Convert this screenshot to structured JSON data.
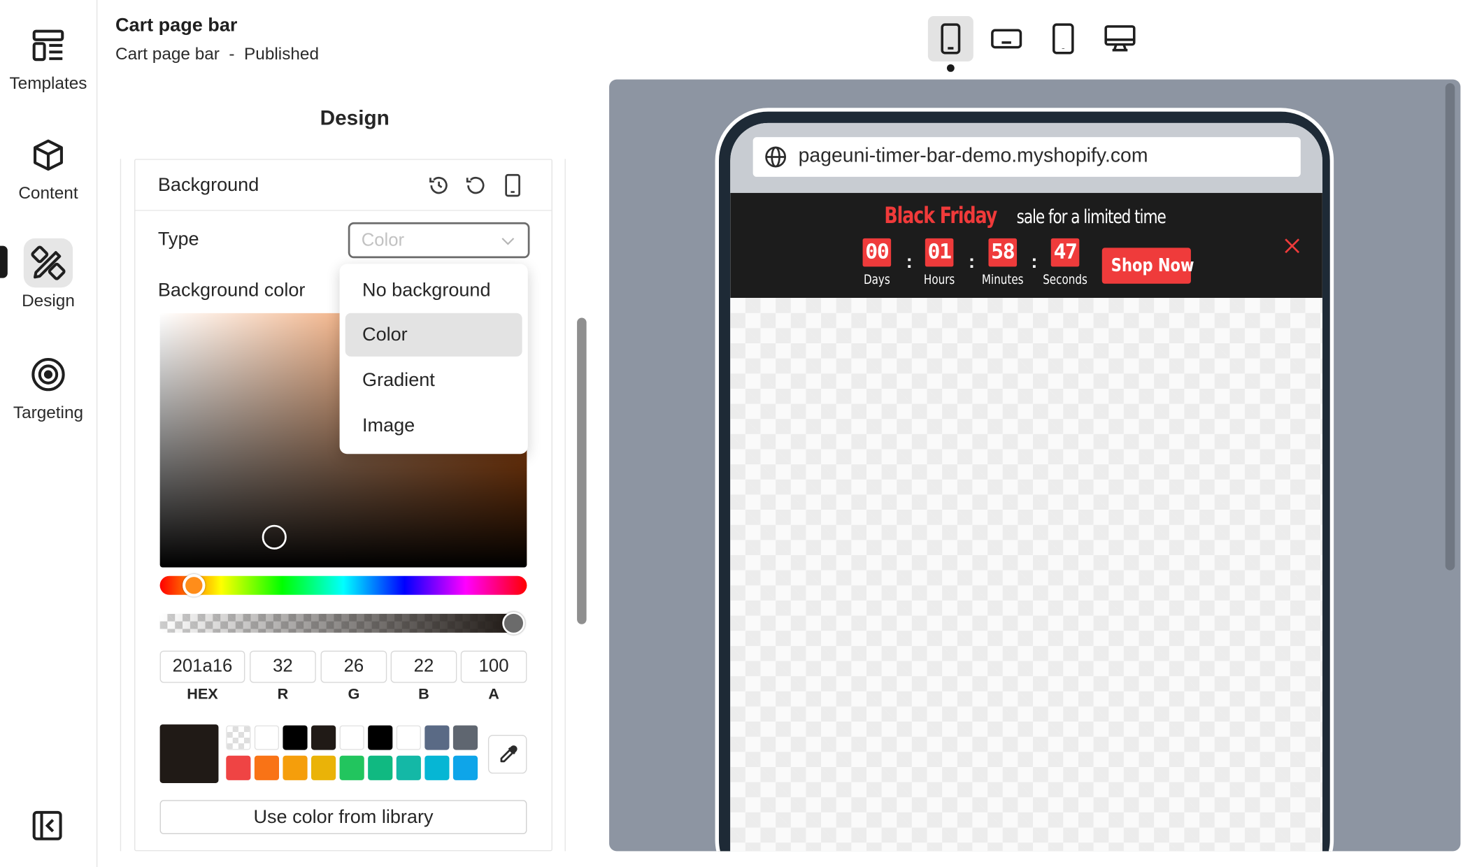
{
  "nav": {
    "items": [
      {
        "label": "Templates",
        "icon": "templates-icon"
      },
      {
        "label": "Content",
        "icon": "cube-icon"
      },
      {
        "label": "Design",
        "icon": "design-tools-icon"
      },
      {
        "label": "Targeting",
        "icon": "target-icon"
      }
    ],
    "active": "Design"
  },
  "doc": {
    "title": "Cart page bar",
    "subtitle": "Cart page bar  -  Published"
  },
  "section": {
    "title": "Design"
  },
  "background_card": {
    "title": "Background",
    "type_label": "Type",
    "type_value": "Color",
    "bg_color_label": "Background color",
    "type_options": [
      "No background",
      "Color",
      "Gradient",
      "Image"
    ],
    "selected_option": "Color"
  },
  "color_picker": {
    "hex": "201a16",
    "r": "32",
    "g": "26",
    "b": "22",
    "a": "100",
    "labels": {
      "hex": "HEX",
      "r": "R",
      "g": "G",
      "b": "B",
      "a": "A"
    },
    "current_color": "#201a16",
    "swatches_row1": [
      "transparent",
      "#ffffff",
      "#000000",
      "#201a16",
      "#ffffff",
      "#000000",
      "#ffffff",
      "#5a6a85",
      "#5f6670"
    ],
    "swatches_row2": [
      "#ef4444",
      "#f97316",
      "#f59e0b",
      "#eab308",
      "#22c55e",
      "#10b981",
      "#14b8a6",
      "#06b6d4",
      "#0ea5e9"
    ],
    "library_button": "Use color from library"
  },
  "devices": [
    "phone-icon",
    "tablet-landscape-icon",
    "tablet-portrait-icon",
    "desktop-icon"
  ],
  "active_device": "phone-icon",
  "preview": {
    "url": "pageuni-timer-bar-demo.myshopify.com",
    "headline_accent": "Black Friday",
    "headline_rest": "sale for a limited time",
    "timer": [
      {
        "value": "00",
        "label": "Days"
      },
      {
        "value": "01",
        "label": "Hours"
      },
      {
        "value": "58",
        "label": "Minutes"
      },
      {
        "value": "47",
        "label": "Seconds"
      }
    ],
    "separator": ":",
    "cta": "Shop Now",
    "accent_color": "#ef3b3b",
    "bar_color": "#1c1c1c"
  }
}
